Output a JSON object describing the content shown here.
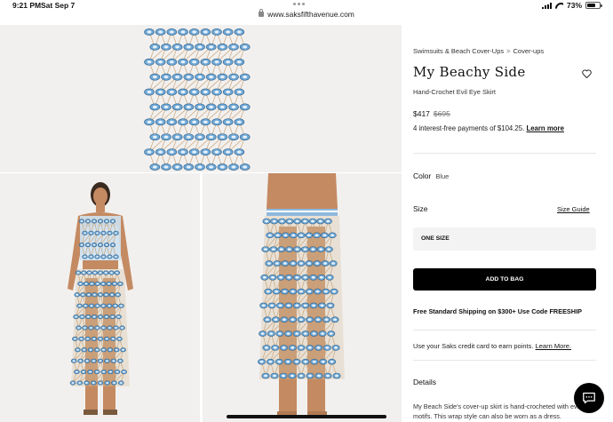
{
  "status_bar": {
    "time": "9:21 PM",
    "date": "Sat Sep 7",
    "url": "www.saksfifthavenue.com",
    "battery": "73%",
    "battery_level": 0.73
  },
  "images": {
    "top_alt": "",
    "left_alt": "",
    "right_alt": ""
  },
  "product": {
    "breadcrumb": [
      "Swimsuits & Beach Cover-Ups",
      "Cover-ups"
    ],
    "breadcrumb_separator": ">",
    "title": "My Beachy Side",
    "subtitle": "Hand-Crochet Evil Eye Skirt",
    "price_now": "$417",
    "price_was": "$695",
    "installments_text": "4 interest-free payments of $104.25.",
    "learn_more": "Learn more",
    "color_label": "Color",
    "color_value": "Blue",
    "size_label": "Size",
    "size_guide": "Size Guide",
    "size_selected": "ONE SIZE",
    "add_to_bag": "ADD TO BAG",
    "shipping": "Free Standard Shipping on $300+ Use Code FREESHIP",
    "saks_card_text": "Use your Saks credit card to earn points.",
    "saks_card_link": "Learn More.",
    "details_heading": "Details",
    "details_text": "My Beach Side's cover-up skirt is hand-crocheted with evil eye motifs. This wrap style can also be worn as a dress."
  },
  "colors": {
    "accent": "#000000",
    "crochet_blue": "#6fa8d6",
    "crochet_tan": "#c9a57a"
  }
}
